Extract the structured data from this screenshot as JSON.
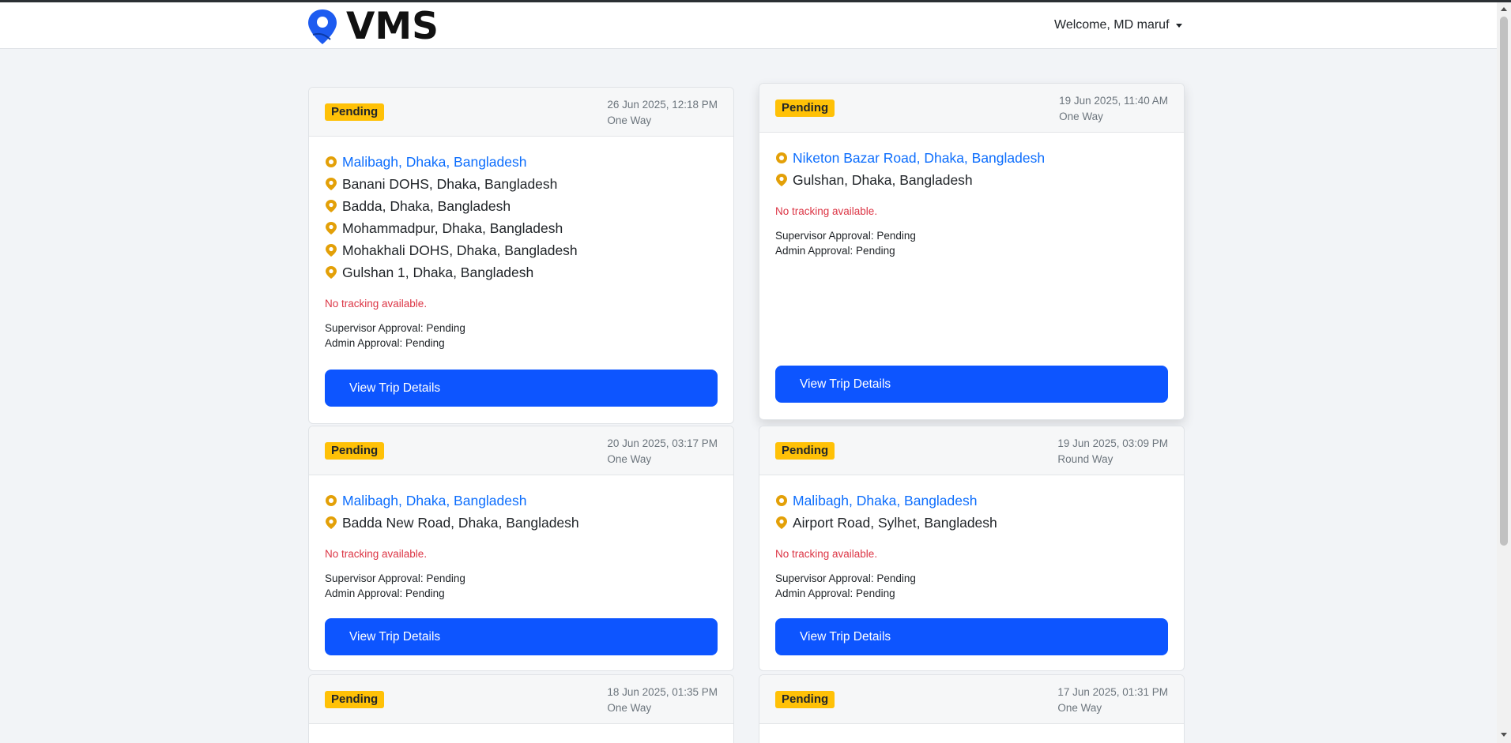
{
  "app": {
    "brand_name": "VMS",
    "user_greeting": "Welcome, MD maruf"
  },
  "colors": {
    "accent": "#0d6efd",
    "button": "#0d55ff",
    "badge": "#ffc107",
    "no_tracking": "#dc3545",
    "pin": "#e3a008"
  },
  "trips": [
    {
      "status": "Pending",
      "datetime": "26 Jun 2025, 12:18 PM",
      "trip_type": "One Way",
      "origin": "Malibagh, Dhaka, Bangladesh",
      "stops": [
        "Banani DOHS, Dhaka, Bangladesh",
        "Badda, Dhaka, Bangladesh",
        "Mohammadpur, Dhaka, Bangladesh",
        "Mohakhali DOHS, Dhaka, Bangladesh",
        "Gulshan 1, Dhaka, Bangladesh"
      ],
      "tracking": "No tracking available.",
      "supervisor_approval": "Supervisor Approval: Pending",
      "admin_approval": "Admin Approval: Pending",
      "button": "View Trip Details"
    },
    {
      "status": "Pending",
      "datetime": "19 Jun 2025, 11:40 AM",
      "trip_type": "One Way",
      "origin": "Niketon Bazar Road, Dhaka, Bangladesh",
      "stops": [
        "Gulshan, Dhaka, Bangladesh"
      ],
      "tracking": "No tracking available.",
      "supervisor_approval": "Supervisor Approval: Pending",
      "admin_approval": "Admin Approval: Pending",
      "button": "View Trip Details"
    },
    {
      "status": "Pending",
      "datetime": "20 Jun 2025, 03:17 PM",
      "trip_type": "One Way",
      "origin": "Malibagh, Dhaka, Bangladesh",
      "stops": [
        "Badda New Road, Dhaka, Bangladesh"
      ],
      "tracking": "No tracking available.",
      "supervisor_approval": "Supervisor Approval: Pending",
      "admin_approval": "Admin Approval: Pending",
      "button": "View Trip Details"
    },
    {
      "status": "Pending",
      "datetime": "19 Jun 2025, 03:09 PM",
      "trip_type": "Round Way",
      "origin": "Malibagh, Dhaka, Bangladesh",
      "stops": [
        "Airport Road, Sylhet, Bangladesh"
      ],
      "tracking": "No tracking available.",
      "supervisor_approval": "Supervisor Approval: Pending",
      "admin_approval": "Admin Approval: Pending",
      "button": "View Trip Details"
    },
    {
      "status": "Pending",
      "datetime": "18 Jun 2025, 01:35 PM",
      "trip_type": "One Way"
    },
    {
      "status": "Pending",
      "datetime": "17 Jun 2025, 01:31 PM",
      "trip_type": "One Way"
    }
  ]
}
